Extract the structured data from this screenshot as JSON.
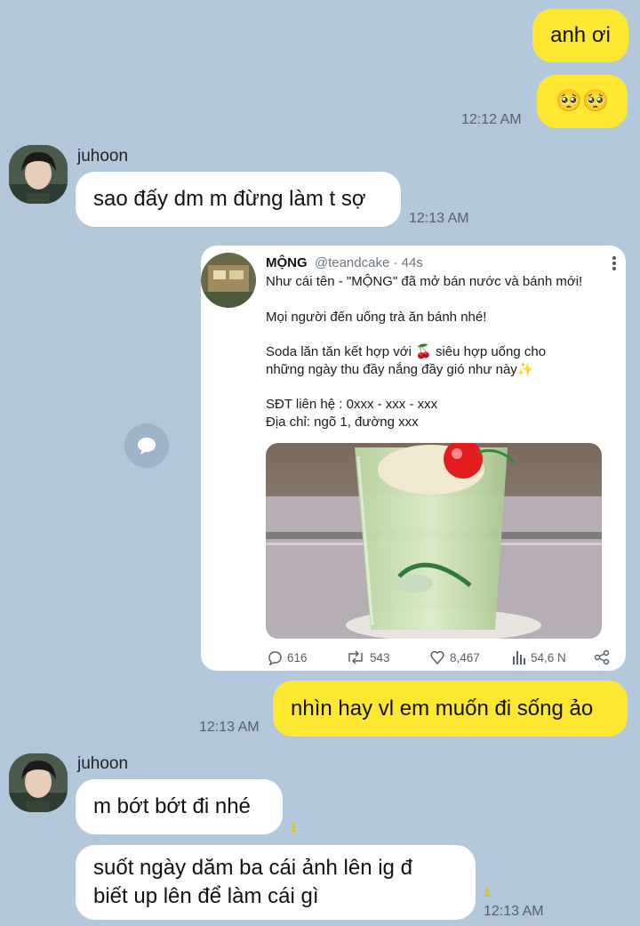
{
  "messages": {
    "m1": "anh ơi",
    "m2_emoji": "🥺🥺",
    "t1": "12:12 AM",
    "sender1": "juhoon",
    "m3": "sao đấy dm m đừng làm t sợ",
    "t2": "12:13 AM",
    "m4": "nhìn hay vl em muốn đi sống ảo",
    "t3": "12:13 AM",
    "sender2": "juhoon",
    "m5": "m bớt bớt đi nhé",
    "unread1": "1",
    "m6_line1": "suốt ngày dăm ba cái ảnh lên ig đ",
    "m6_line2": "biết up lên để làm cái gì",
    "unread2": "1",
    "t4": "12:13 AM"
  },
  "tweet": {
    "name": "MỘNG",
    "handle_time": "@teandcake · 44s",
    "line1": "Như cái tên - \"MỘNG\" đã mở bán nước và bánh mới!",
    "line2": "Mọi người đến uống trà ăn bánh nhé!",
    "line3a": "Soda lăn tăn kết hợp với 🍒 siêu hợp uống cho",
    "line3b": "những ngày thu đầy nắng đầy gió như này✨",
    "line4a": "SĐT liên hệ : 0xxx - xxx - xxx",
    "line4b": "Địa chỉ: ngõ 1, đường xxx",
    "stats": {
      "replies": "616",
      "retweets": "543",
      "likes": "8,467",
      "views": "54,6 N"
    }
  },
  "icons": [
    "reply-icon",
    "retweet-icon",
    "like-icon",
    "views-icon",
    "share-icon",
    "more-icon",
    "share-chat-icon"
  ],
  "colors": {
    "background": "#b3c7da",
    "my_bubble": "#fde730",
    "their_bubble": "#ffffff",
    "unread": "#e6c200"
  }
}
